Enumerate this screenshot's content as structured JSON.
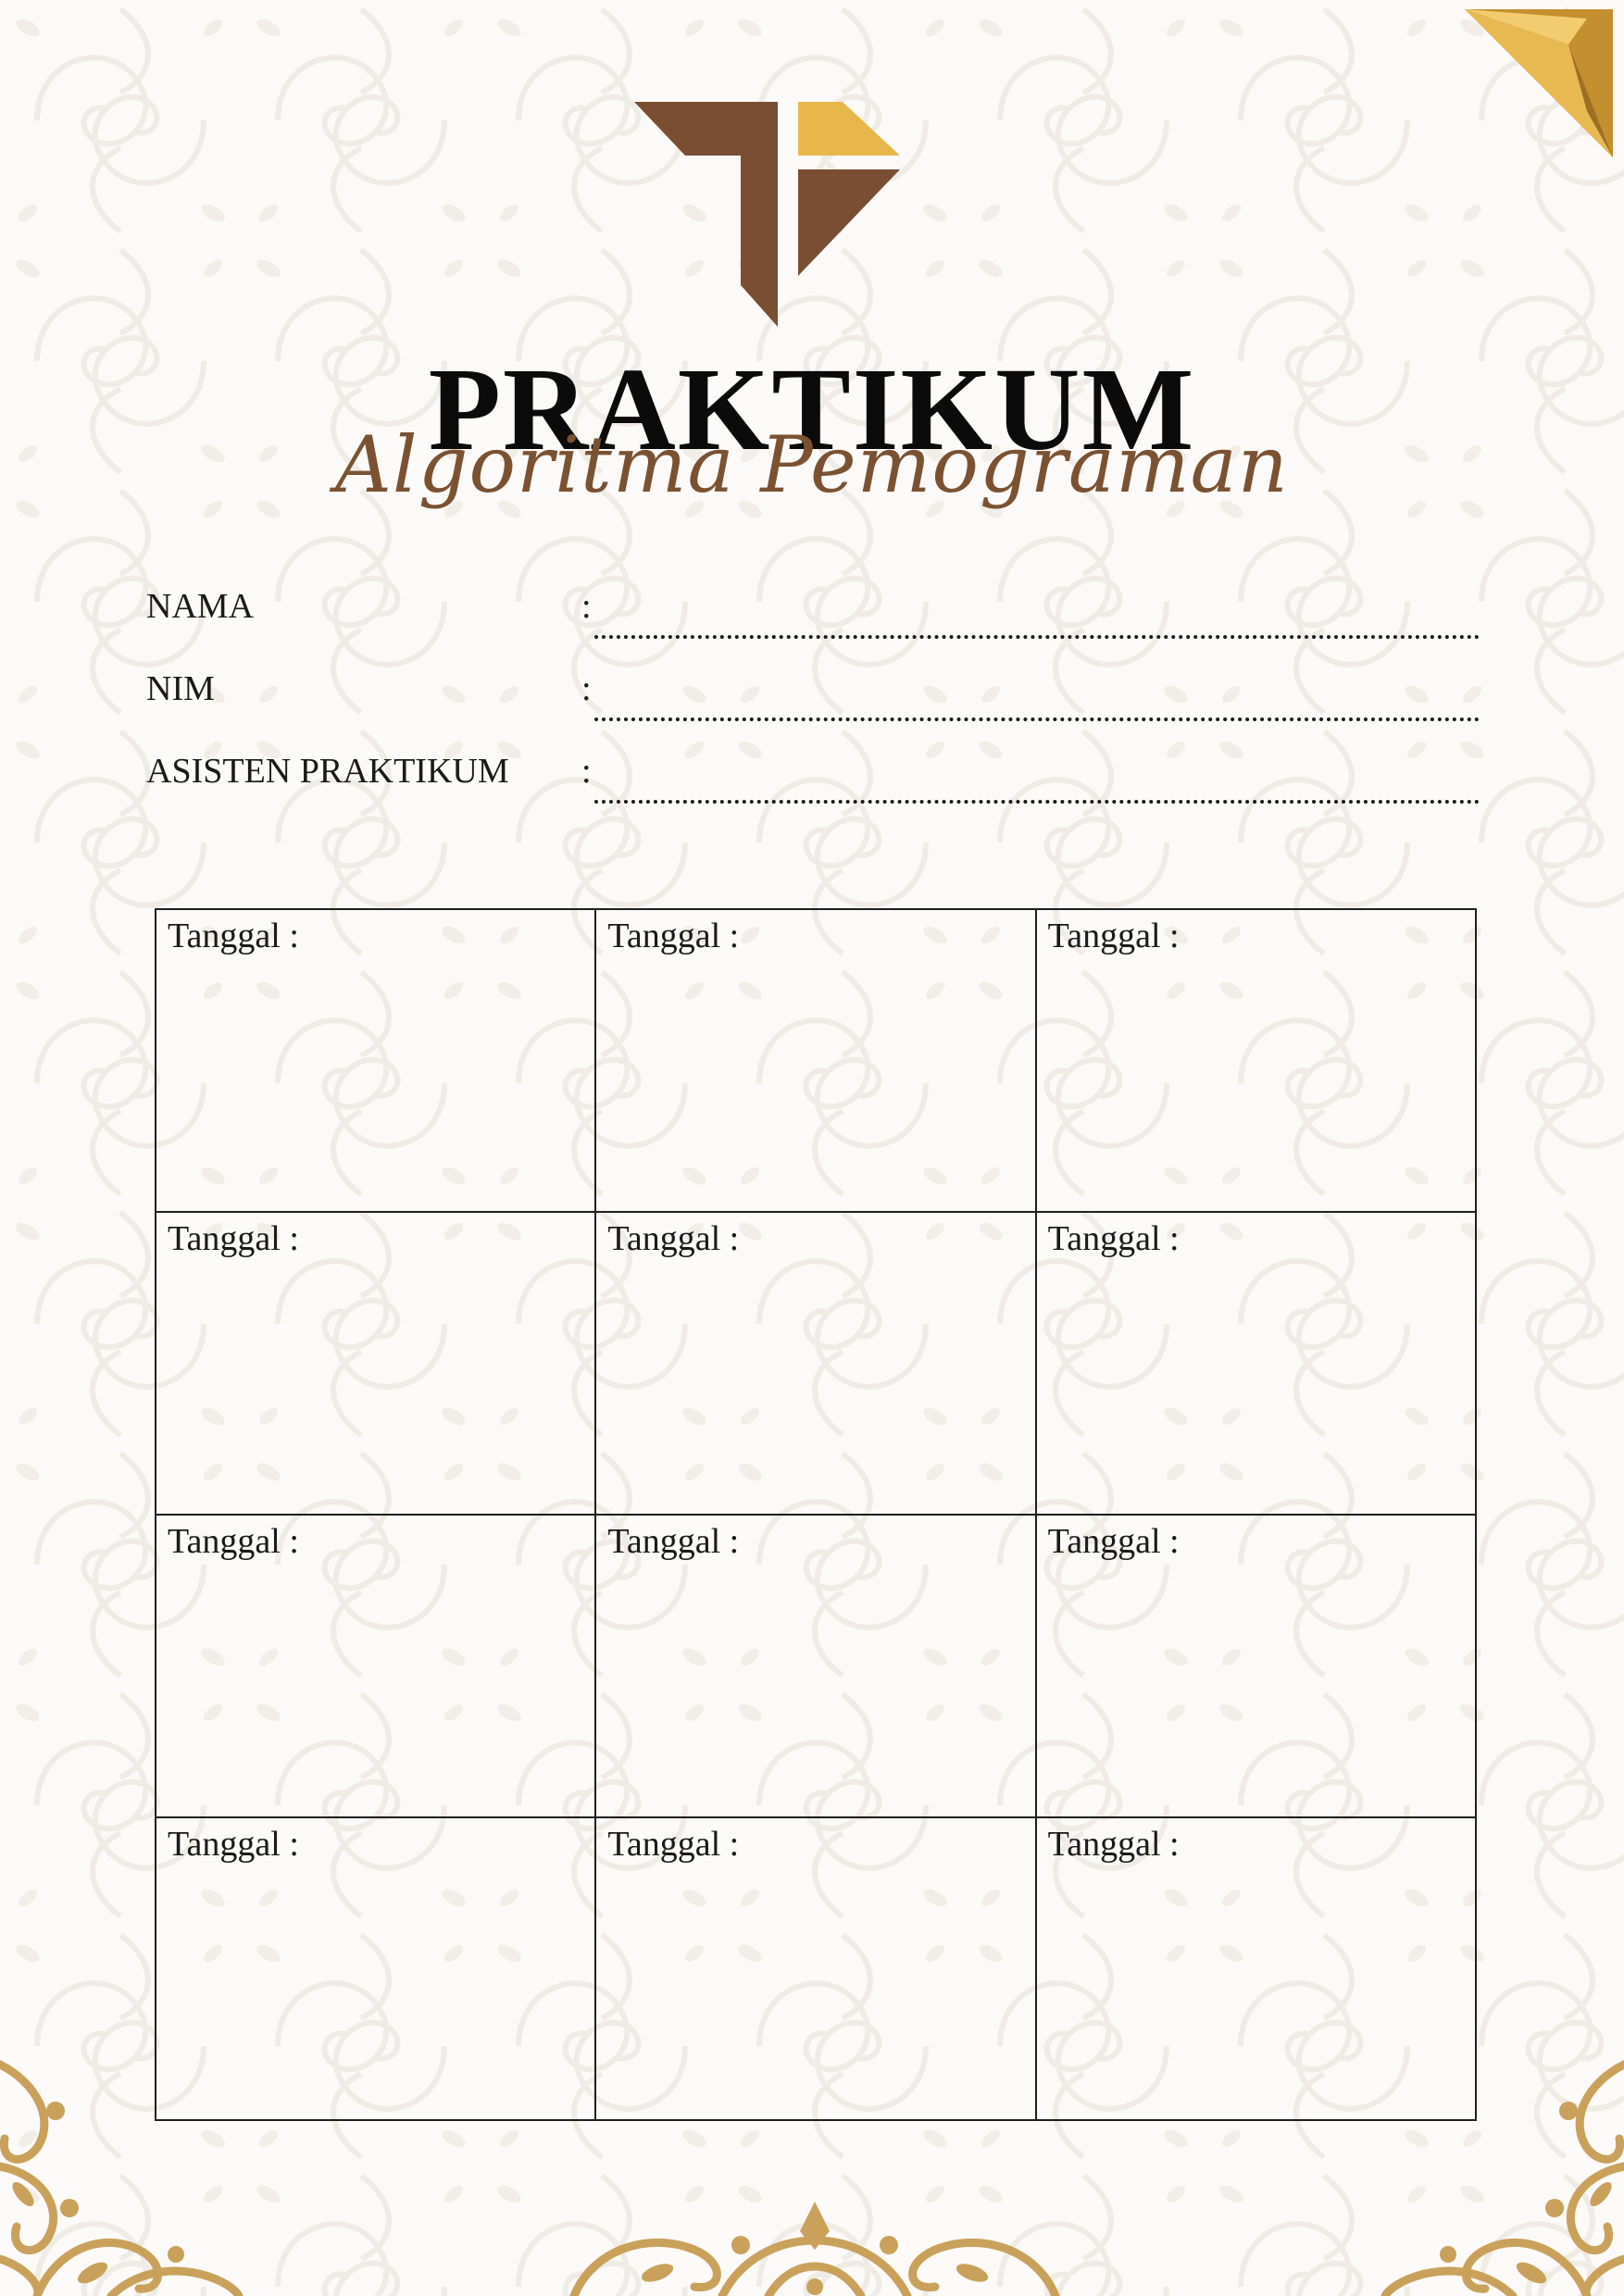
{
  "header": {
    "title": "PRAKTIKUM",
    "subtitle": "Algoritma Pemograman"
  },
  "fields": [
    {
      "label": "NAMA",
      "separator": ":"
    },
    {
      "label": "NIM",
      "separator": ":"
    },
    {
      "label": "ASISTEN PRAKTIKUM",
      "separator": ":"
    }
  ],
  "grid": {
    "rows": [
      [
        "Tanggal :",
        "Tanggal :",
        "Tanggal :"
      ],
      [
        "Tanggal :",
        "Tanggal :",
        "Tanggal :"
      ],
      [
        "Tanggal :",
        "Tanggal :",
        "Tanggal :"
      ],
      [
        "Tanggal :",
        "Tanggal :",
        "Tanggal :"
      ]
    ]
  },
  "colors": {
    "logo_brown": "#7a4e33",
    "logo_gold": "#e7b74b",
    "ornament_gold": "#c9a15a",
    "subtitle_brown": "#7a5232",
    "fold_gold": "#d9a843"
  },
  "icons": {
    "logo": "praktikum-logo-icon",
    "corner": "corner-fold-icon",
    "ornaments": "gold-scroll-ornament-icon"
  }
}
